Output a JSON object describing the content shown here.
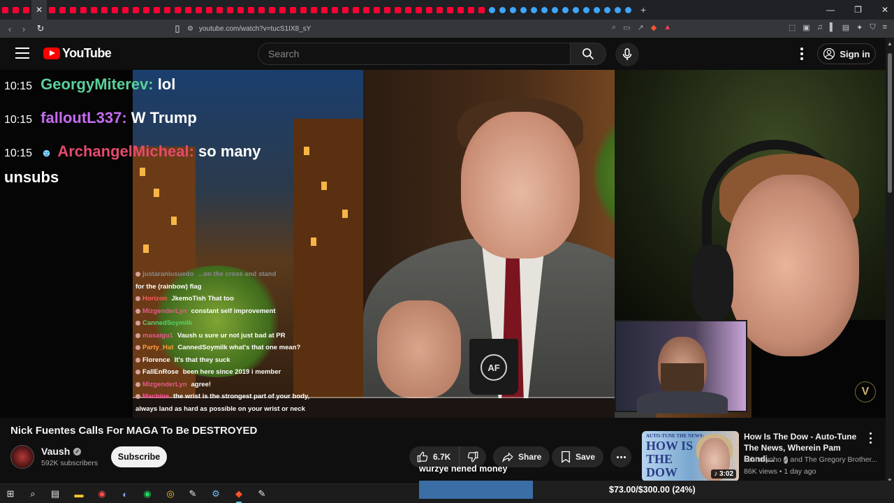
{
  "browser": {
    "url": "youtube.com/watch?v=tucS1IX8_sY",
    "new_tab_label": "+",
    "close_tab_label": "✕",
    "window_controls": [
      "—",
      "❐",
      "✕"
    ]
  },
  "masthead": {
    "logo_text": "YouTube",
    "search_placeholder": "Search",
    "sign_in_label": "Sign in"
  },
  "chat_large": [
    {
      "time": "10:15",
      "user": "GeorgyMiterev",
      "message": "lol",
      "color": "#5bcf9a"
    },
    {
      "time": "10:15",
      "user": "falloutL337",
      "message": "W Trump",
      "color": "#c46cf0"
    },
    {
      "time": "10:15",
      "user": "ArchangelMicheal",
      "message": "so many unsubs",
      "color": "#e34b6b"
    }
  ],
  "chat_small": [
    {
      "user": "justaraniusuedo",
      "message": "...on the cross and stand",
      "color": "#8a8a8a"
    },
    {
      "user": "",
      "message": "for the (rainbow) flag",
      "color": "#ffffff"
    },
    {
      "user": "Horizon",
      "message": "JkemoTish That too",
      "color": "#ff5a5a"
    },
    {
      "user": "MizgenderLyn",
      "message": "constant self improvement",
      "color": "#e85a8a"
    },
    {
      "user": "CannedSoymilk",
      "message": "",
      "color": "#5dd06a"
    },
    {
      "user": "masaigu1",
      "message": "Vaush u sure ur not just bad at PR",
      "color": "#e85a8a"
    },
    {
      "user": "Party_Hat",
      "message": "CannedSoymilk what's that one mean?",
      "color": "#ff9c3a"
    },
    {
      "user": "Florence",
      "message": "It's that they suck",
      "color": "#ffffff"
    },
    {
      "user": "FallEnRose",
      "message": "been here since 2019    i member",
      "color": "#ffffff"
    },
    {
      "user": "MizgenderLyn",
      "message": "agree!",
      "color": "#e85a8a"
    },
    {
      "user": "Machine",
      "message": "the wrist is the strongest part of your body,",
      "color": "#ff4fa0"
    },
    {
      "user": "",
      "message": "always land as hard as possible on your wrist or neck",
      "color": "#ffffff"
    }
  ],
  "video": {
    "title": "Nick Fuentes Calls For MAGA To Be DESTROYED",
    "mug_logo": "AF",
    "badge_letter": "V",
    "channel": "Vaush",
    "subscribers": "592K subscribers",
    "subscribe_label": "Subscribe",
    "likes": "6.7K",
    "share_label": "Share",
    "save_label": "Save",
    "caption": "wurzye nened money"
  },
  "recommendation": {
    "thumb_small": "AUTO-TUNE THE NEWS:",
    "thumb_big": "HOW IS THE DOW",
    "duration": "3:02",
    "title": "How Is The Dow - Auto-Tune The News, Wherein Pam Bondi...",
    "channel": "schmoyoho",
    "channel_extra": "and The Gregory Brother...",
    "meta": "86K views • 1 day ago"
  },
  "goal": {
    "text": "$73.00/$300.00 (24%)",
    "fraction": 0.24
  },
  "icons": [
    "menu-icon",
    "search-icon",
    "mic-icon",
    "account-icon",
    "like-icon",
    "dislike-icon",
    "share-icon",
    "save-icon",
    "windows-start-icon"
  ]
}
